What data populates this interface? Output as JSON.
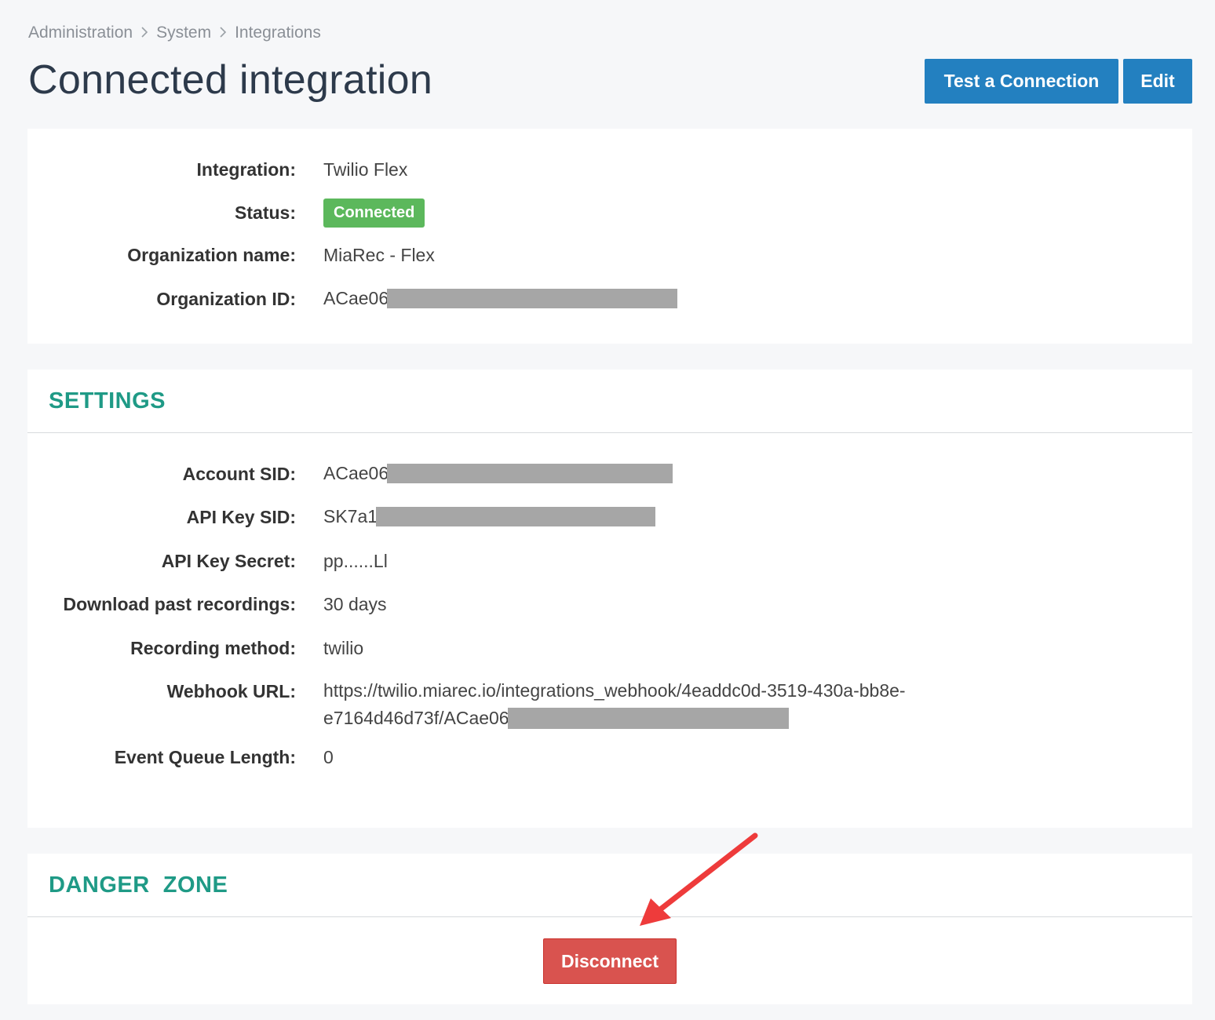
{
  "breadcrumb": {
    "items": [
      "Administration",
      "System",
      "Integrations"
    ],
    "separator": ">"
  },
  "page": {
    "title": "Connected integration"
  },
  "toolbar": {
    "test_label": "Test a Connection",
    "edit_label": "Edit"
  },
  "info": {
    "integration_label": "Integration:",
    "integration_value": "Twilio Flex",
    "status_label": "Status:",
    "status_value": "Connected",
    "org_name_label": "Organization name:",
    "org_name_value": "MiaRec - Flex",
    "org_id_label": "Organization ID:",
    "org_id_value": "ACae06"
  },
  "settings": {
    "heading": "SETTINGS",
    "account_sid_label": "Account SID:",
    "account_sid_value": "ACae06",
    "api_key_sid_label": "API Key SID:",
    "api_key_sid_value": "SK7a1",
    "api_key_secret_label": "API Key Secret:",
    "api_key_secret_value": "pp......Ll",
    "download_label": "Download past recordings:",
    "download_value": "30 days",
    "recording_method_label": "Recording method:",
    "recording_method_value": "twilio",
    "webhook_label": "Webhook URL:",
    "webhook_line1": "https://twilio.miarec.io/integrations_webhook/4eaddc0d-3519-430a-bb8e-",
    "webhook_line2": "e7164d46d73f/ACae06",
    "event_queue_label": "Event Queue Length:",
    "event_queue_value": "0"
  },
  "danger": {
    "heading": "DANGER  ZONE",
    "disconnect_label": "Disconnect"
  },
  "colors": {
    "primary": "#2380c0",
    "success": "#5cb85c",
    "danger": "#d9534f",
    "section_heading": "#1f9a86",
    "annotation_arrow": "#ee3b3b"
  }
}
